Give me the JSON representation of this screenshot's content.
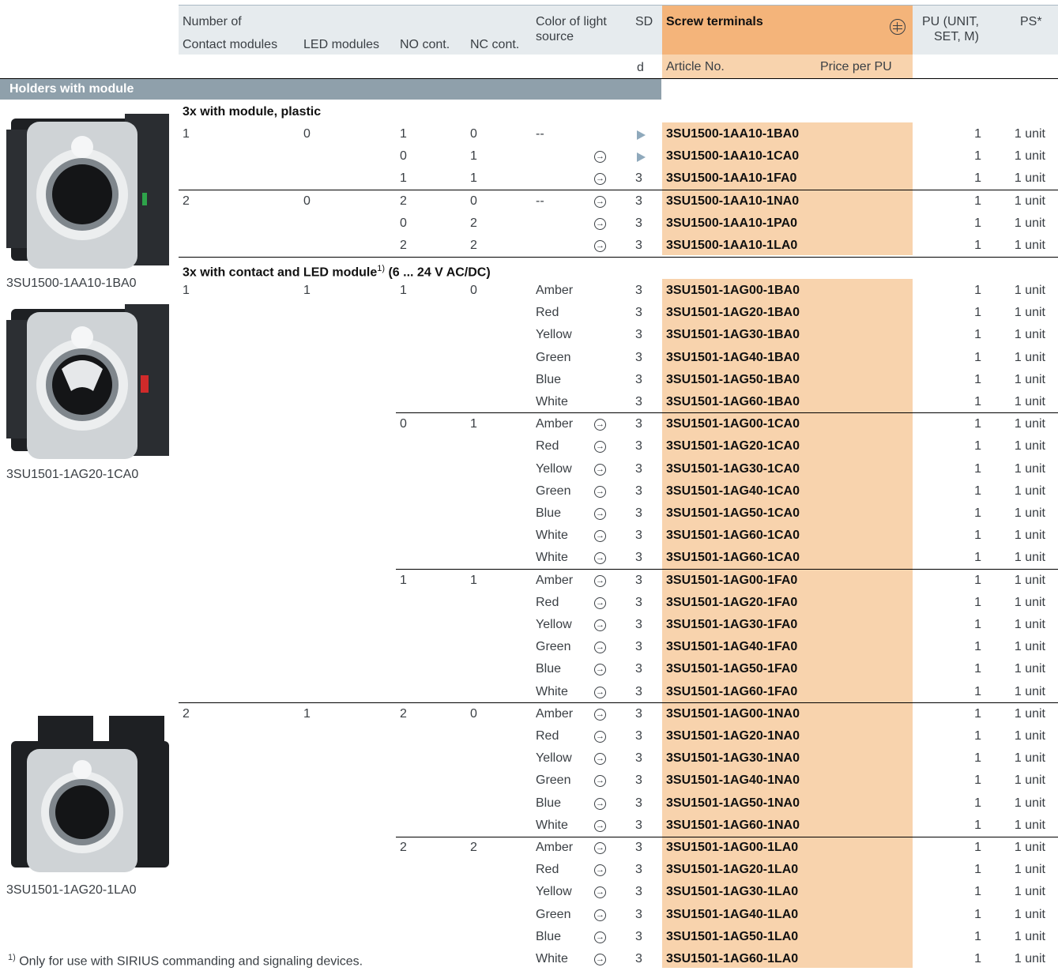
{
  "header": {
    "number_of": "Number of",
    "contact_modules": "Contact modules",
    "led_modules": "LED modules",
    "no_cont": "NO cont.",
    "nc_cont": "NC cont.",
    "color_line1": "Color of light",
    "color_line2": "source",
    "sd": "SD",
    "sd_unit": "d",
    "screw_terminals": "Screw terminals",
    "article_no": "Article No.",
    "price_per_pu": "Price per PU",
    "pu_line1": "PU (UNIT,",
    "pu_line2": "SET, M)",
    "ps": "PS*"
  },
  "section_title": "Holders with module",
  "subheading1": "3x with module, plastic",
  "subheading2": "3x with contact and LED module",
  "subheading2_sup": "1)",
  "subheading2_tail": " (6 ... 24 V AC/DC)",
  "captions": [
    "3SU1500-1AA10-1BA0",
    "3SU1501-1AG20-1CA0",
    "3SU1501-1AG20-1LA0"
  ],
  "footnote_sup": "1)",
  "footnote_text": "Only for use with SIRIUS commanding and signaling devices.",
  "rows": [
    {
      "cm": "1",
      "lm": "0",
      "no": "1",
      "nc": "0",
      "color": "--",
      "icon": "",
      "sd": "",
      "tri": true,
      "art": "3SU1500-1AA10-1BA0",
      "pu": "1",
      "ps": "1 unit"
    },
    {
      "cm": "",
      "lm": "",
      "no": "0",
      "nc": "1",
      "color": "",
      "icon": "→",
      "sd": "",
      "tri": true,
      "art": "3SU1500-1AA10-1CA0",
      "pu": "1",
      "ps": "1 unit"
    },
    {
      "cm": "",
      "lm": "",
      "no": "1",
      "nc": "1",
      "color": "",
      "icon": "→",
      "sd": "3",
      "tri": false,
      "art": "3SU1500-1AA10-1FA0",
      "pu": "1",
      "ps": "1 unit"
    },
    {
      "cm": "2",
      "lm": "0",
      "no": "2",
      "nc": "0",
      "color": "--",
      "icon": "→",
      "sd": "3",
      "tri": false,
      "art": "3SU1500-1AA10-1NA0",
      "pu": "1",
      "ps": "1 unit"
    },
    {
      "cm": "",
      "lm": "",
      "no": "0",
      "nc": "2",
      "color": "",
      "icon": "→",
      "sd": "3",
      "tri": false,
      "art": "3SU1500-1AA10-1PA0",
      "pu": "1",
      "ps": "1 unit"
    },
    {
      "cm": "",
      "lm": "",
      "no": "2",
      "nc": "2",
      "color": "",
      "icon": "→",
      "sd": "3",
      "tri": false,
      "art": "3SU1500-1AA10-1LA0",
      "pu": "1",
      "ps": "1 unit"
    },
    {
      "cm": "1",
      "lm": "1",
      "no": "1",
      "nc": "0",
      "color": "Amber",
      "icon": "",
      "sd": "3",
      "tri": false,
      "art": "3SU1501-1AG00-1BA0",
      "pu": "1",
      "ps": "1 unit"
    },
    {
      "cm": "",
      "lm": "",
      "no": "",
      "nc": "",
      "color": "Red",
      "icon": "",
      "sd": "3",
      "tri": false,
      "art": "3SU1501-1AG20-1BA0",
      "pu": "1",
      "ps": "1 unit"
    },
    {
      "cm": "",
      "lm": "",
      "no": "",
      "nc": "",
      "color": "Yellow",
      "icon": "",
      "sd": "3",
      "tri": false,
      "art": "3SU1501-1AG30-1BA0",
      "pu": "1",
      "ps": "1 unit"
    },
    {
      "cm": "",
      "lm": "",
      "no": "",
      "nc": "",
      "color": "Green",
      "icon": "",
      "sd": "3",
      "tri": false,
      "art": "3SU1501-1AG40-1BA0",
      "pu": "1",
      "ps": "1 unit"
    },
    {
      "cm": "",
      "lm": "",
      "no": "",
      "nc": "",
      "color": "Blue",
      "icon": "",
      "sd": "3",
      "tri": false,
      "art": "3SU1501-1AG50-1BA0",
      "pu": "1",
      "ps": "1 unit"
    },
    {
      "cm": "",
      "lm": "",
      "no": "",
      "nc": "",
      "color": "White",
      "icon": "",
      "sd": "3",
      "tri": false,
      "art": "3SU1501-1AG60-1BA0",
      "pu": "1",
      "ps": "1 unit"
    },
    {
      "cm": "",
      "lm": "",
      "no": "0",
      "nc": "1",
      "color": "Amber",
      "icon": "→",
      "sd": "3",
      "tri": false,
      "art": "3SU1501-1AG00-1CA0",
      "pu": "1",
      "ps": "1 unit"
    },
    {
      "cm": "",
      "lm": "",
      "no": "",
      "nc": "",
      "color": "Red",
      "icon": "→",
      "sd": "3",
      "tri": false,
      "art": "3SU1501-1AG20-1CA0",
      "pu": "1",
      "ps": "1 unit"
    },
    {
      "cm": "",
      "lm": "",
      "no": "",
      "nc": "",
      "color": "Yellow",
      "icon": "→",
      "sd": "3",
      "tri": false,
      "art": "3SU1501-1AG30-1CA0",
      "pu": "1",
      "ps": "1 unit"
    },
    {
      "cm": "",
      "lm": "",
      "no": "",
      "nc": "",
      "color": "Green",
      "icon": "→",
      "sd": "3",
      "tri": false,
      "art": "3SU1501-1AG40-1CA0",
      "pu": "1",
      "ps": "1 unit"
    },
    {
      "cm": "",
      "lm": "",
      "no": "",
      "nc": "",
      "color": "Blue",
      "icon": "→",
      "sd": "3",
      "tri": false,
      "art": "3SU1501-1AG50-1CA0",
      "pu": "1",
      "ps": "1 unit"
    },
    {
      "cm": "",
      "lm": "",
      "no": "",
      "nc": "",
      "color": "White",
      "icon": "→",
      "sd": "3",
      "tri": false,
      "art": "3SU1501-1AG60-1CA0",
      "pu": "1",
      "ps": "1 unit"
    },
    {
      "cm": "",
      "lm": "",
      "no": "",
      "nc": "",
      "color": "White",
      "icon": "→",
      "sd": "3",
      "tri": false,
      "art": "3SU1501-1AG60-1CA0",
      "pu": "1",
      "ps": "1 unit"
    },
    {
      "cm": "",
      "lm": "",
      "no": "1",
      "nc": "1",
      "color": "Amber",
      "icon": "→",
      "sd": "3",
      "tri": false,
      "art": "3SU1501-1AG00-1FA0",
      "pu": "1",
      "ps": "1 unit"
    },
    {
      "cm": "",
      "lm": "",
      "no": "",
      "nc": "",
      "color": "Red",
      "icon": "→",
      "sd": "3",
      "tri": false,
      "art": "3SU1501-1AG20-1FA0",
      "pu": "1",
      "ps": "1 unit"
    },
    {
      "cm": "",
      "lm": "",
      "no": "",
      "nc": "",
      "color": "Yellow",
      "icon": "→",
      "sd": "3",
      "tri": false,
      "art": "3SU1501-1AG30-1FA0",
      "pu": "1",
      "ps": "1 unit"
    },
    {
      "cm": "",
      "lm": "",
      "no": "",
      "nc": "",
      "color": "Green",
      "icon": "→",
      "sd": "3",
      "tri": false,
      "art": "3SU1501-1AG40-1FA0",
      "pu": "1",
      "ps": "1 unit"
    },
    {
      "cm": "",
      "lm": "",
      "no": "",
      "nc": "",
      "color": "Blue",
      "icon": "→",
      "sd": "3",
      "tri": false,
      "art": "3SU1501-1AG50-1FA0",
      "pu": "1",
      "ps": "1 unit"
    },
    {
      "cm": "",
      "lm": "",
      "no": "",
      "nc": "",
      "color": "White",
      "icon": "→",
      "sd": "3",
      "tri": false,
      "art": "3SU1501-1AG60-1FA0",
      "pu": "1",
      "ps": "1 unit"
    },
    {
      "cm": "2",
      "lm": "1",
      "no": "2",
      "nc": "0",
      "color": "Amber",
      "icon": "→",
      "sd": "3",
      "tri": false,
      "art": "3SU1501-1AG00-1NA0",
      "pu": "1",
      "ps": "1 unit"
    },
    {
      "cm": "",
      "lm": "",
      "no": "",
      "nc": "",
      "color": "Red",
      "icon": "→",
      "sd": "3",
      "tri": false,
      "art": "3SU1501-1AG20-1NA0",
      "pu": "1",
      "ps": "1 unit"
    },
    {
      "cm": "",
      "lm": "",
      "no": "",
      "nc": "",
      "color": "Yellow",
      "icon": "→",
      "sd": "3",
      "tri": false,
      "art": "3SU1501-1AG30-1NA0",
      "pu": "1",
      "ps": "1 unit"
    },
    {
      "cm": "",
      "lm": "",
      "no": "",
      "nc": "",
      "color": "Green",
      "icon": "→",
      "sd": "3",
      "tri": false,
      "art": "3SU1501-1AG40-1NA0",
      "pu": "1",
      "ps": "1 unit"
    },
    {
      "cm": "",
      "lm": "",
      "no": "",
      "nc": "",
      "color": "Blue",
      "icon": "→",
      "sd": "3",
      "tri": false,
      "art": "3SU1501-1AG50-1NA0",
      "pu": "1",
      "ps": "1 unit"
    },
    {
      "cm": "",
      "lm": "",
      "no": "",
      "nc": "",
      "color": "White",
      "icon": "→",
      "sd": "3",
      "tri": false,
      "art": "3SU1501-1AG60-1NA0",
      "pu": "1",
      "ps": "1 unit"
    },
    {
      "cm": "",
      "lm": "",
      "no": "2",
      "nc": "2",
      "color": "Amber",
      "icon": "→",
      "sd": "3",
      "tri": false,
      "art": "3SU1501-1AG00-1LA0",
      "pu": "1",
      "ps": "1 unit"
    },
    {
      "cm": "",
      "lm": "",
      "no": "",
      "nc": "",
      "color": "Red",
      "icon": "→",
      "sd": "3",
      "tri": false,
      "art": "3SU1501-1AG20-1LA0",
      "pu": "1",
      "ps": "1 unit"
    },
    {
      "cm": "",
      "lm": "",
      "no": "",
      "nc": "",
      "color": "Yellow",
      "icon": "→",
      "sd": "3",
      "tri": false,
      "art": "3SU1501-1AG30-1LA0",
      "pu": "1",
      "ps": "1 unit"
    },
    {
      "cm": "",
      "lm": "",
      "no": "",
      "nc": "",
      "color": "Green",
      "icon": "→",
      "sd": "3",
      "tri": false,
      "art": "3SU1501-1AG40-1LA0",
      "pu": "1",
      "ps": "1 unit"
    },
    {
      "cm": "",
      "lm": "",
      "no": "",
      "nc": "",
      "color": "Blue",
      "icon": "→",
      "sd": "3",
      "tri": false,
      "art": "3SU1501-1AG50-1LA0",
      "pu": "1",
      "ps": "1 unit"
    },
    {
      "cm": "",
      "lm": "",
      "no": "",
      "nc": "",
      "color": "White",
      "icon": "→",
      "sd": "3",
      "tri": false,
      "art": "3SU1501-1AG60-1LA0",
      "pu": "1",
      "ps": "1 unit"
    }
  ],
  "colors": {
    "header_bg": "#e6ebee",
    "section_bar": "#8fa0ab",
    "screw_header": "#f4b47a",
    "article_bg": "#f8d3ad",
    "triangle": "#8fa9bc"
  }
}
